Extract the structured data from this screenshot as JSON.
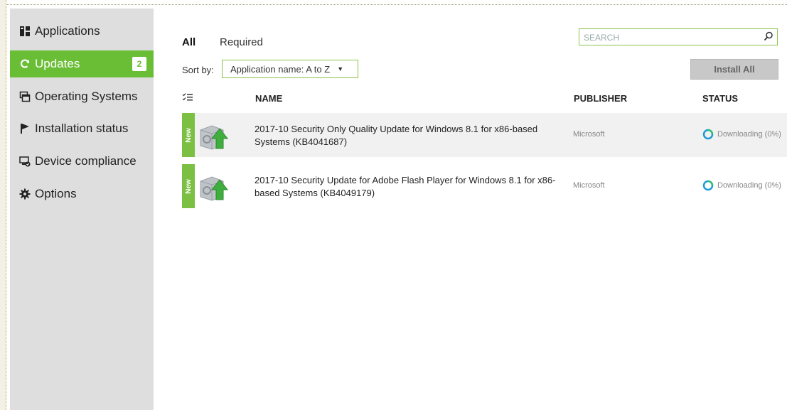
{
  "sidebar": {
    "items": [
      {
        "label": "Applications",
        "icon": "applications-icon",
        "active": false
      },
      {
        "label": "Updates",
        "icon": "refresh-icon",
        "active": true,
        "badge": "2"
      },
      {
        "label": "Operating Systems",
        "icon": "operating-systems-icon",
        "active": false
      },
      {
        "label": "Installation status",
        "icon": "flag-icon",
        "active": false
      },
      {
        "label": "Device compliance",
        "icon": "device-compliance-icon",
        "active": false
      },
      {
        "label": "Options",
        "icon": "gear-icon",
        "active": false
      }
    ]
  },
  "tabs": {
    "all": "All",
    "required": "Required"
  },
  "search": {
    "placeholder": "SEARCH",
    "icon": "search-icon"
  },
  "sort": {
    "label": "Sort by:",
    "value": "Application name: A to Z"
  },
  "install_all": "Install All",
  "columns": {
    "name": "NAME",
    "publisher": "PUBLISHER",
    "status": "STATUS"
  },
  "rows": [
    {
      "tag": "New",
      "name": "2017-10 Security Only Quality Update for Windows 8.1 for x86-based Systems (KB4041687)",
      "publisher": "Microsoft",
      "status": "Downloading (0%)"
    },
    {
      "tag": "New",
      "name": "2017-10 Security Update for Adobe Flash Player for Windows 8.1 for x86-based Systems (KB4049179)",
      "publisher": "Microsoft",
      "status": "Downloading (0%)"
    }
  ],
  "colors": {
    "accent": "#6abe36",
    "sidebar_bg": "#dedede",
    "new_tag": "#7cc043"
  }
}
